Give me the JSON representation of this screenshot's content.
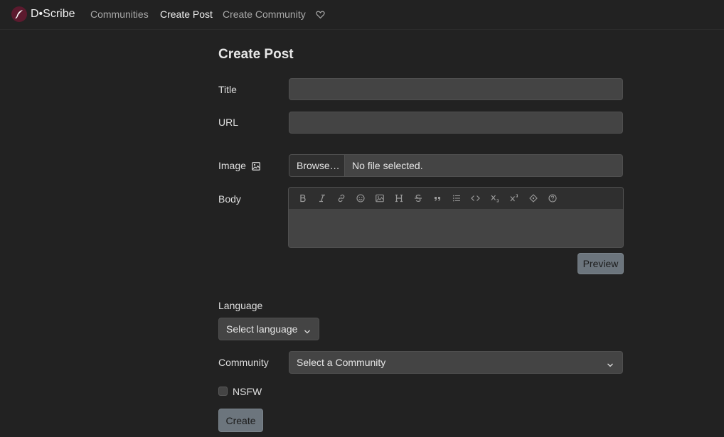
{
  "nav": {
    "brand": "D•Scribe",
    "links": [
      "Communities",
      "Create Post",
      "Create Community"
    ],
    "active": "Create Post",
    "heart_icon": "heart-icon"
  },
  "form": {
    "title": "Create Post",
    "title_label": "Title",
    "title_value": "",
    "url_label": "URL",
    "url_value": "",
    "image_label": "Image",
    "browse_label": "Browse…",
    "file_status": "No file selected.",
    "body_label": "Body",
    "body_value": "",
    "toolbar": [
      "bold-icon",
      "italic-icon",
      "link-icon",
      "emoji-icon",
      "image-icon",
      "header-icon",
      "strikethrough-icon",
      "quote-icon",
      "list-icon",
      "code-icon",
      "subscript-icon",
      "superscript-icon",
      "spoiler-icon",
      "help-icon"
    ],
    "preview_label": "Preview",
    "language_label": "Language",
    "language_value": "Select language",
    "community_label": "Community",
    "community_value": "Select a Community",
    "nsfw_label": "NSFW",
    "nsfw_checked": false,
    "create_label": "Create"
  },
  "colors": {
    "background": "#222222",
    "input": "#444444",
    "button": "#6c757d",
    "logo": "#5c1a2e"
  }
}
